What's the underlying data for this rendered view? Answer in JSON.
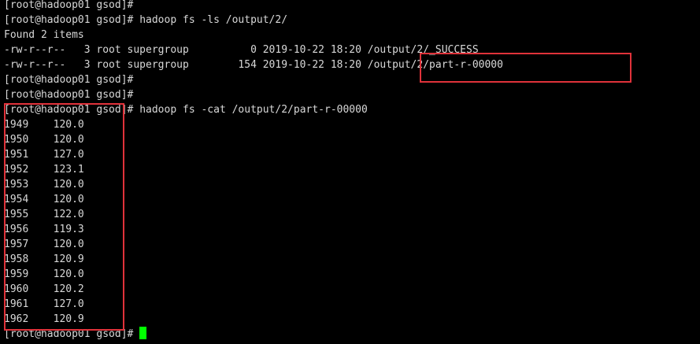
{
  "colors": {
    "background": "#000000",
    "text": "#d8d8d8",
    "cursor": "#00ff00",
    "highlight": "#e0323a"
  },
  "terminal": {
    "prompt": "[root@hadoop01 gsod]#",
    "lines": [
      {
        "kind": "prompt",
        "command": ""
      },
      {
        "kind": "prompt",
        "command": "hadoop fs -ls /output/2/"
      },
      {
        "kind": "text",
        "text": "Found 2 items"
      },
      {
        "kind": "text",
        "text": "-rw-r--r--   3 root supergroup          0 2019-10-22 18:20 /output/2/_SUCCESS"
      },
      {
        "kind": "text",
        "text": "-rw-r--r--   3 root supergroup        154 2019-10-22 18:20 /output/2/part-r-00000"
      },
      {
        "kind": "prompt",
        "command": ""
      },
      {
        "kind": "prompt",
        "command": ""
      },
      {
        "kind": "prompt",
        "command": "hadoop fs -cat /output/2/part-r-00000"
      }
    ],
    "results": [
      {
        "year": "1949",
        "value": "120.0"
      },
      {
        "year": "1950",
        "value": "120.0"
      },
      {
        "year": "1951",
        "value": "127.0"
      },
      {
        "year": "1952",
        "value": "123.1"
      },
      {
        "year": "1953",
        "value": "120.0"
      },
      {
        "year": "1954",
        "value": "120.0"
      },
      {
        "year": "1955",
        "value": "122.0"
      },
      {
        "year": "1956",
        "value": "119.3"
      },
      {
        "year": "1957",
        "value": "120.0"
      },
      {
        "year": "1958",
        "value": "120.9"
      },
      {
        "year": "1959",
        "value": "120.0"
      },
      {
        "year": "1960",
        "value": "120.2"
      },
      {
        "year": "1961",
        "value": "127.0"
      },
      {
        "year": "1962",
        "value": "120.9"
      }
    ],
    "final_prompt": {
      "kind": "prompt",
      "command": ""
    }
  }
}
